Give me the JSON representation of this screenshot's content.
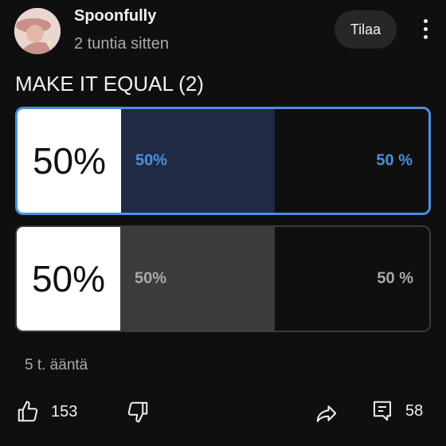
{
  "post": {
    "channel_name": "Spoonfully",
    "time": "2 tuntia sitten",
    "subscribe_label": "Tilaa",
    "title": "MAKE IT EQUAL (2)"
  },
  "poll": {
    "options": [
      {
        "image_text": "50%",
        "label": "50%",
        "result": "50 %",
        "fraction": 0.5,
        "selected": true
      },
      {
        "image_text": "50%",
        "label": "50%",
        "result": "50 %",
        "fraction": 0.5,
        "selected": false
      }
    ],
    "votes_text": "5 t. ääntä"
  },
  "actions": {
    "like_count": "153",
    "comment_count": "58"
  },
  "icons": [
    "avatar",
    "more-icon",
    "thumbs-up-icon",
    "thumbs-down-icon",
    "share-icon",
    "comment-icon"
  ],
  "colors": {
    "accent": "#4a90e2",
    "background": "#0f0f0f"
  }
}
